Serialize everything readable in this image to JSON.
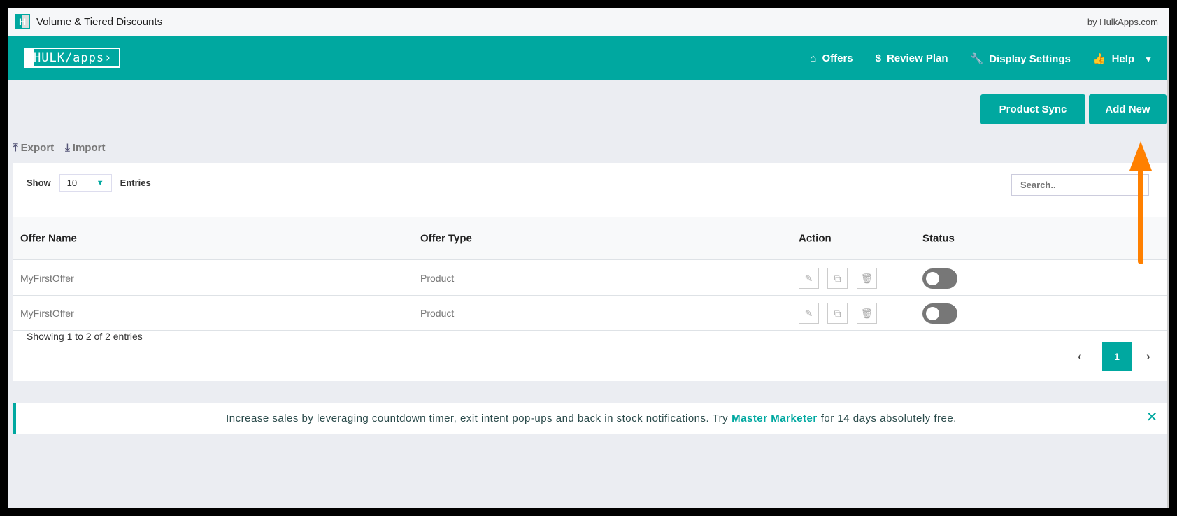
{
  "window": {
    "title": "Volume & Tiered Discounts",
    "by": "by HulkApps.com",
    "app_icon": "H"
  },
  "header": {
    "logo": "HULK/apps›",
    "nav": [
      {
        "icon": "home-icon",
        "glyph": "⌂",
        "label": "Offers"
      },
      {
        "icon": "dollar-icon",
        "glyph": "$",
        "label": "Review Plan"
      },
      {
        "icon": "wrench-icon",
        "glyph": "🔧",
        "label": "Display Settings"
      },
      {
        "icon": "thumbs-up-icon",
        "glyph": "👍",
        "label": "Help"
      }
    ],
    "help_caret": "▼"
  },
  "actions": {
    "product_sync": "Product Sync",
    "add_new": "Add New"
  },
  "tools": {
    "export": "Export",
    "import": "Import"
  },
  "table": {
    "show_label": "Show",
    "entries_label": "Entries",
    "page_size": "10",
    "search_placeholder": "Search..",
    "columns": [
      "Offer Name",
      "Offer Type",
      "Action",
      "Status"
    ],
    "rows": [
      {
        "name": "MyFirstOffer",
        "type": "Product",
        "status": false
      },
      {
        "name": "MyFirstOffer",
        "type": "Product",
        "status": false
      }
    ],
    "footer": "Showing 1 to 2 of 2 entries",
    "current_page": "1"
  },
  "banner": {
    "before": "Increase sales by leveraging countdown timer, exit intent pop-ups and back in stock notifications. Try",
    "link": "Master Marketer",
    "after": "for 14 days absolutely free.",
    "close": "✕"
  },
  "colors": {
    "accent": "#00a8a0",
    "annotation_arrow": "#ff8000"
  }
}
